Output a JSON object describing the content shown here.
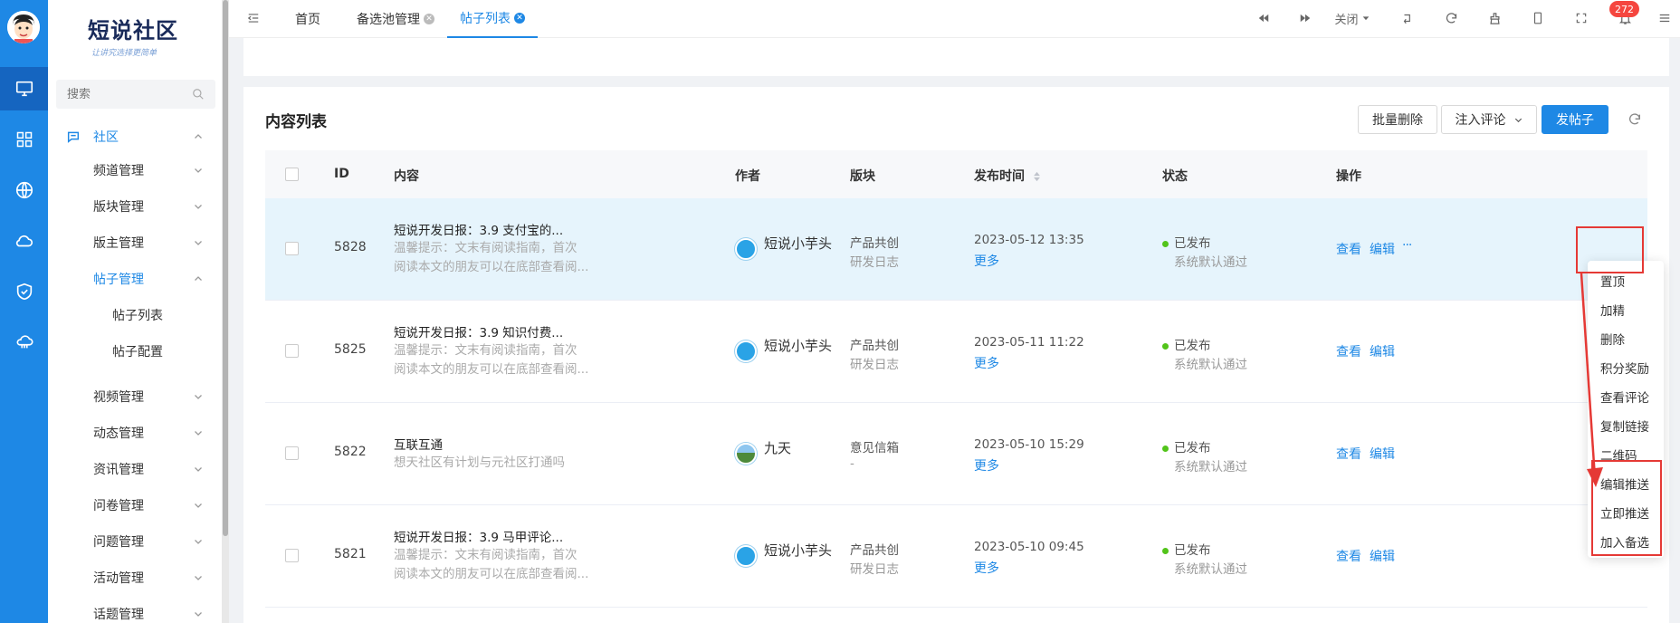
{
  "sidebar": {
    "logo_title": "短说社区",
    "logo_subtitle": "让讲究选择更简单",
    "search_placeholder": "搜索",
    "section": "社区",
    "items": {
      "channel": "频道管理",
      "block": "版块管理",
      "moderator": "版主管理",
      "post": "帖子管理",
      "post_list": "帖子列表",
      "post_config": "帖子配置",
      "video": "视频管理",
      "dynamic": "动态管理",
      "news": "资讯管理",
      "survey": "问卷管理",
      "question": "问题管理",
      "activity": "活动管理",
      "topic": "话题管理"
    }
  },
  "tabs": {
    "home": "首页",
    "candidate": "备选池管理",
    "post_list": "帖子列表"
  },
  "toolbar": {
    "close_label": "关闭",
    "notification_count": "272"
  },
  "card": {
    "title": "内容列表",
    "batch_delete": "批量删除",
    "inject_comment": "注入评论",
    "post_button": "发帖子"
  },
  "table": {
    "headers": {
      "id": "ID",
      "content": "内容",
      "author": "作者",
      "block": "版块",
      "publish_time": "发布时间",
      "status": "状态",
      "action": "操作"
    },
    "rows": [
      {
        "id": "5828",
        "title": "短说开发日报：3.9 支付宝的...",
        "sub1": "温馨提示：文末有阅读指南，首次",
        "sub2": "阅读本文的朋友可以在底部查看阅...",
        "author": "短说小芋头",
        "block1": "产品共创",
        "block2": "研发日志",
        "time": "2023-05-12 13:35",
        "more": "更多",
        "status": "已发布",
        "status_sub": "系统默认通过",
        "view": "查看",
        "edit": "编辑",
        "ellipsis": "···"
      },
      {
        "id": "5825",
        "title": "短说开发日报：3.9 知识付费...",
        "sub1": "温馨提示：文末有阅读指南，首次",
        "sub2": "阅读本文的朋友可以在底部查看阅...",
        "author": "短说小芋头",
        "block1": "产品共创",
        "block2": "研发日志",
        "time": "2023-05-11 11:22",
        "more": "更多",
        "status": "已发布",
        "status_sub": "系统默认通过",
        "view": "查看",
        "edit": "编辑"
      },
      {
        "id": "5822",
        "title": "互联互通",
        "sub1": "想天社区有计划与元社区打通吗",
        "sub2": "",
        "author": "九天",
        "block1": "意见信箱",
        "block2": "-",
        "time": "2023-05-10 15:29",
        "more": "更多",
        "status": "已发布",
        "status_sub": "系统默认通过",
        "view": "查看",
        "edit": "编辑"
      },
      {
        "id": "5821",
        "title": "短说开发日报：3.9 马甲评论...",
        "sub1": "温馨提示：文末有阅读指南，首次",
        "sub2": "阅读本文的朋友可以在底部查看阅...",
        "author": "短说小芋头",
        "block1": "产品共创",
        "block2": "研发日志",
        "time": "2023-05-10 09:45",
        "more": "更多",
        "status": "已发布",
        "status_sub": "系统默认通过",
        "view": "查看",
        "edit": "编辑"
      }
    ]
  },
  "dropdown": {
    "items": [
      "置顶",
      "加精",
      "删除",
      "积分奖励",
      "查看评论",
      "复制链接",
      "二维码",
      "编辑推送",
      "立即推送",
      "加入备选"
    ]
  },
  "colors": {
    "accent": "#1e88e5",
    "highlight_row": "#e6f4fc",
    "annotation_red": "#e53935",
    "status_green": "#52c41a"
  }
}
